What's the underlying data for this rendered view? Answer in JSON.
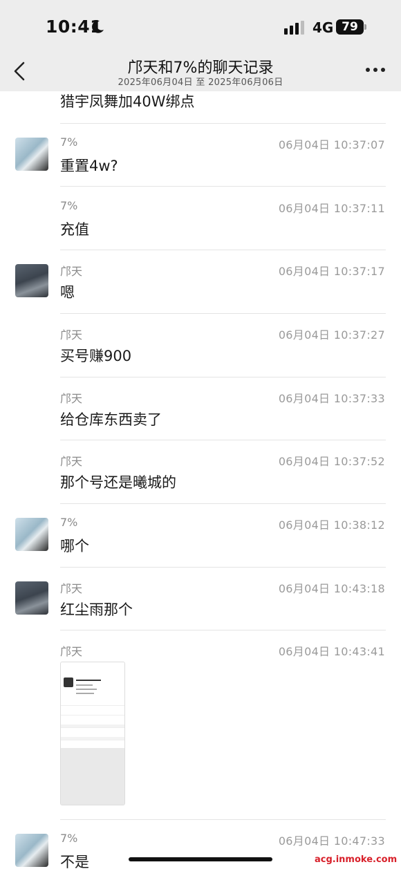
{
  "status_bar": {
    "time": "10:41",
    "network": "4G",
    "battery": "79"
  },
  "nav": {
    "title": "邝天和7%的聊天记录",
    "subtitle": "2025年06月04日 至 2025年06月06日"
  },
  "partial_message": "猎宇凤舞加40W绑点",
  "messages": [
    {
      "sender": "7%",
      "timestamp": "06月04日 10:37:07",
      "text": "重置4w?"
    },
    {
      "sender": "7%",
      "timestamp": "06月04日 10:37:11",
      "text": "充值"
    },
    {
      "sender": "邝天",
      "timestamp": "06月04日 10:37:17",
      "text": "嗯"
    },
    {
      "sender": "邝天",
      "timestamp": "06月04日 10:37:27",
      "text": "买号赚900"
    },
    {
      "sender": "邝天",
      "timestamp": "06月04日 10:37:33",
      "text": "给仓库东西卖了"
    },
    {
      "sender": "邝天",
      "timestamp": "06月04日 10:37:52",
      "text": "那个号还是曦城的"
    },
    {
      "sender": "7%",
      "timestamp": "06月04日 10:38:12",
      "text": "哪个"
    },
    {
      "sender": "邝天",
      "timestamp": "06月04日 10:43:18",
      "text": "红尘雨那个"
    },
    {
      "sender": "邝天",
      "timestamp": "06月04日 10:43:41",
      "text": ""
    },
    {
      "sender": "7%",
      "timestamp": "06月04日 10:47:33",
      "text": "不是"
    }
  ],
  "watermark": "acg.inmoke.com",
  "colors": {
    "topbar_bg": "#ededed",
    "watermark": "#d8202a"
  }
}
